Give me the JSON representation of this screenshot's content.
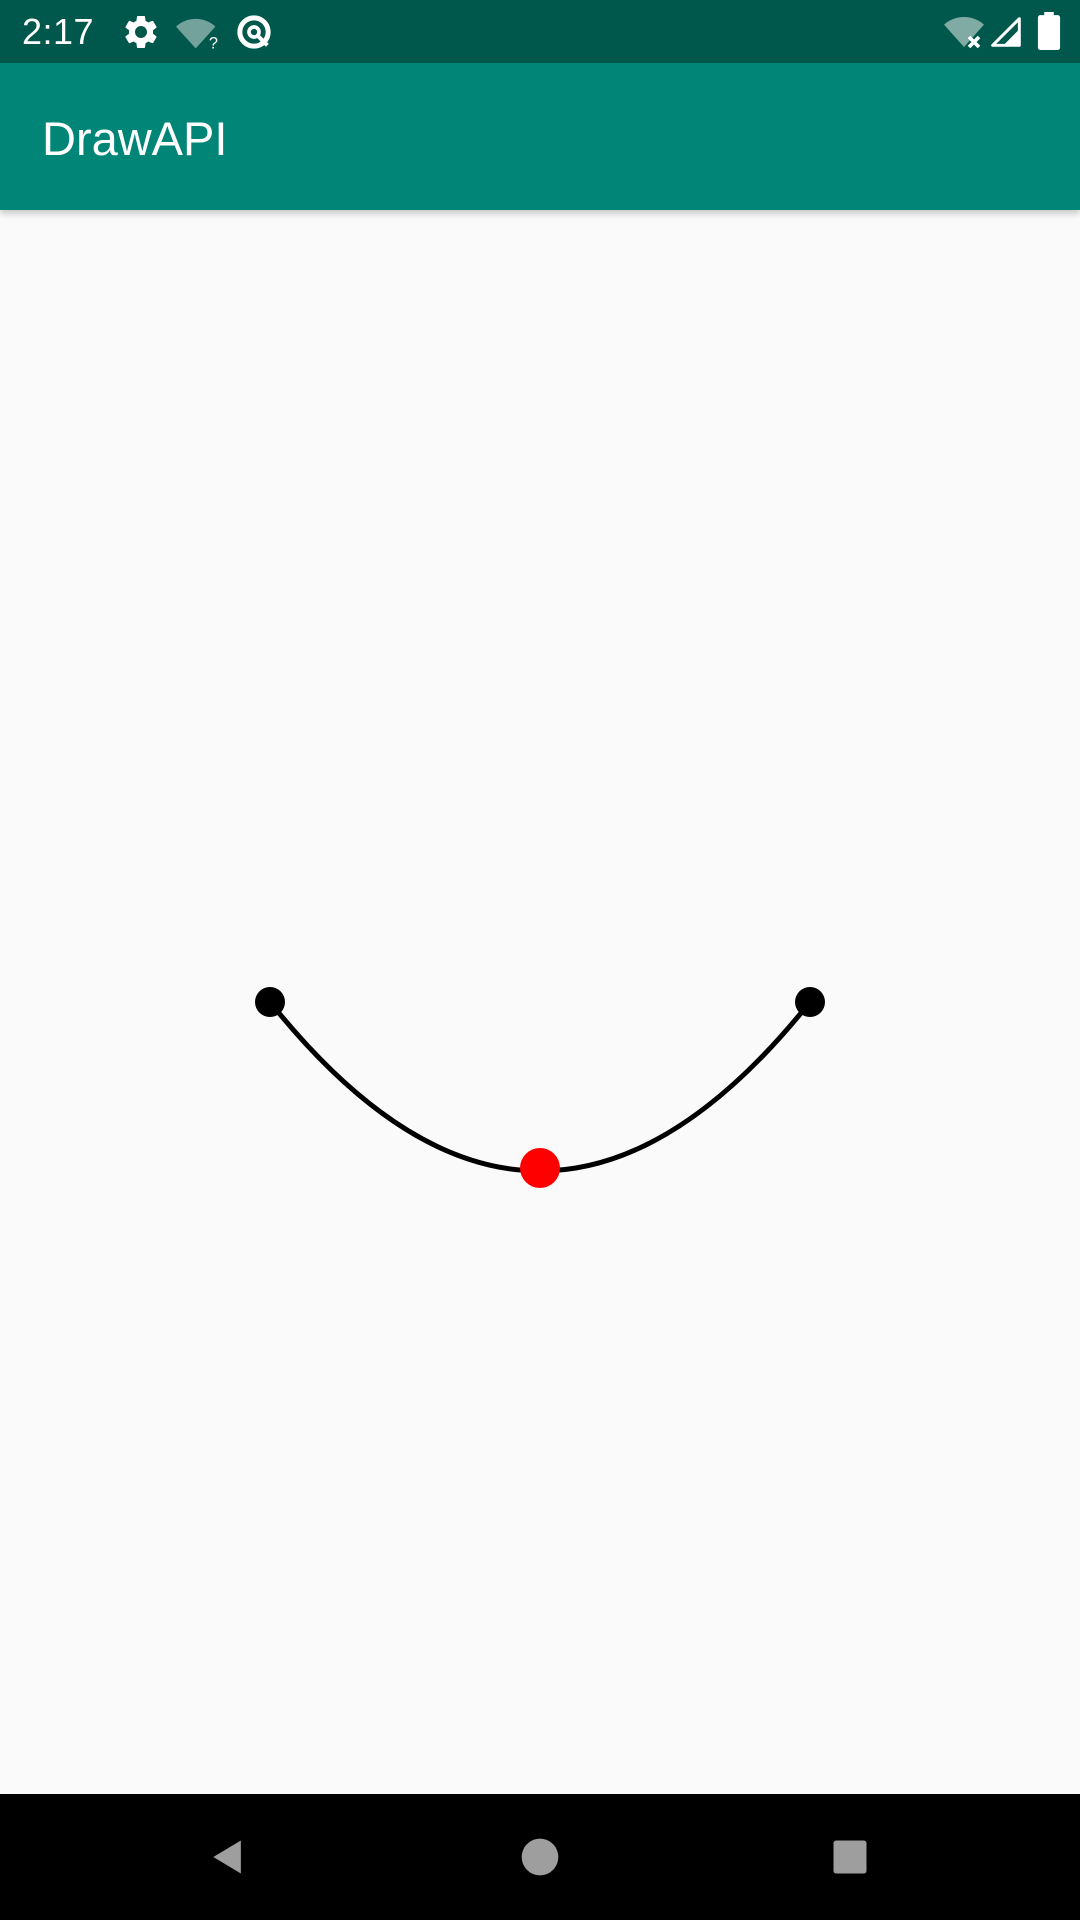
{
  "status_bar": {
    "time": "2:17",
    "icons": [
      "settings-icon",
      "wifi-unknown-icon",
      "data-saver-icon",
      "wifi-off-icon",
      "signal-icon",
      "battery-icon"
    ],
    "background": "#00574b"
  },
  "app_bar": {
    "title": "DrawAPI",
    "background": "#008577",
    "title_color": "#ffffff"
  },
  "canvas": {
    "background": "#fafafa",
    "curve_color": "#000000",
    "endpoint_color": "#000000",
    "control_point_color": "#ff0000"
  },
  "nav_bar": {
    "buttons": [
      "back-icon",
      "home-icon",
      "recents-icon"
    ],
    "background": "#000000",
    "icon_color": "#9e9e9e"
  }
}
